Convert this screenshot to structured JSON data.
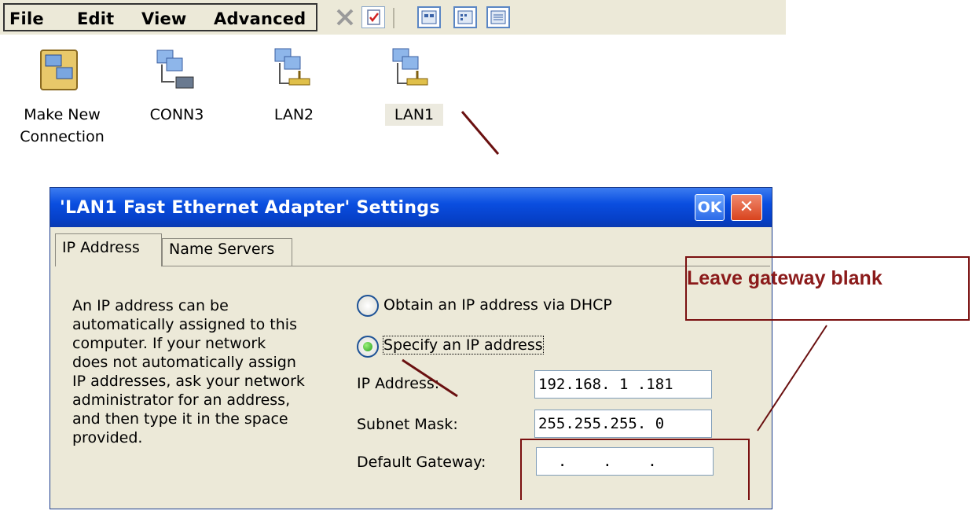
{
  "menu": {
    "items": [
      {
        "label": "File"
      },
      {
        "label": "Edit"
      },
      {
        "label": "View"
      },
      {
        "label": "Advanced"
      }
    ]
  },
  "toolbar": {
    "buttons": [
      {
        "icon": "delete-icon"
      },
      {
        "icon": "properties-icon"
      },
      {
        "icon": "large-icons-view-icon"
      },
      {
        "icon": "small-icons-view-icon"
      },
      {
        "icon": "details-view-icon"
      }
    ]
  },
  "desktop": {
    "icons": [
      {
        "label_line1": "Make New",
        "label_line2": "Connection",
        "icon": "make-new-connection-icon"
      },
      {
        "label": "CONN3",
        "icon": "dialup-connection-icon"
      },
      {
        "label": "LAN2",
        "icon": "lan-connection-icon"
      },
      {
        "label": "LAN1",
        "icon": "lan-connection-icon"
      }
    ]
  },
  "dialog": {
    "title": "'LAN1 Fast Ethernet Adapter' Settings",
    "ok_label": "OK",
    "close_label": "✕",
    "tabs": [
      {
        "label": "IP Address",
        "active": true
      },
      {
        "label": "Name Servers",
        "active": false
      }
    ],
    "description": [
      "An IP address can be",
      "automatically assigned to this",
      "computer.  If your network",
      "does not automatically assign",
      "IP addresses, ask your network",
      "administrator for an address,",
      "and then type it in the space",
      "provided."
    ],
    "radio_dhcp": {
      "label": "Obtain an IP address via DHCP",
      "selected": false
    },
    "radio_specify": {
      "label": "Specify an IP address",
      "selected": true
    },
    "fields": {
      "ip_label": "IP Address:",
      "ip_value": "192.168. 1 .181",
      "mask_label": "Subnet Mask:",
      "mask_value": "255.255.255. 0",
      "gateway_label": "Default Gateway:",
      "gateway_value": "  .    .    .  "
    }
  },
  "annotation": {
    "text": "Leave gateway blank",
    "color": "#8b1a1a"
  },
  "colors": {
    "titlebar": "#0a4ee0",
    "dialog_bg": "#ece9d8",
    "annotation": "#7a1010"
  }
}
